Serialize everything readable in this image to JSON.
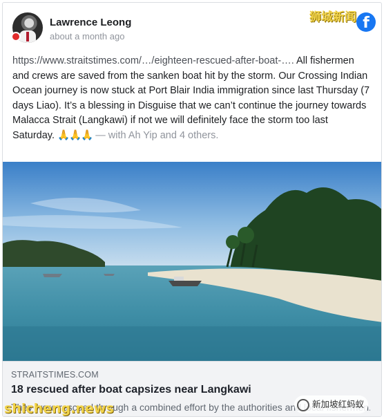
{
  "post": {
    "author": "Lawrence Leong",
    "timestamp": "about a month ago",
    "link_text": "https://www.straitstimes.com/…/eighteen-rescued-after-boat-….",
    "body_text": " All fishermen and crews are saved from the sanken boat hit by the storm. Our Crossing Indian Ocean journey is now stuck at Port Blair India immigration since last Thursday (7 days Liao). It’s a blessing in Disguise that we can’t continue the journey towards Malacca Strait (Langkawi) if not we will definitely face the storm too last Saturday. ",
    "emoji": "🙏🙏🙏",
    "with_text": " — with Ah Yip and 4 others."
  },
  "link_preview": {
    "domain": "STRAITSTIMES.COM",
    "headline": "18 rescued after boat capsizes near Langkawi",
    "description": "They were rescued through a combined effort by the authorities and local fishermen."
  },
  "watermarks": {
    "top_right": "狮城新闻",
    "bottom_left": "shicheng.news",
    "bottom_right": "新加坡红蚂蚁"
  },
  "icons": {
    "facebook": "f",
    "facebook_icon": "facebook-logo-icon",
    "wechat_icon": "wechat-icon"
  },
  "colors": {
    "facebook_blue": "#1877f2",
    "watermark_yellow": "#f1d34a"
  }
}
